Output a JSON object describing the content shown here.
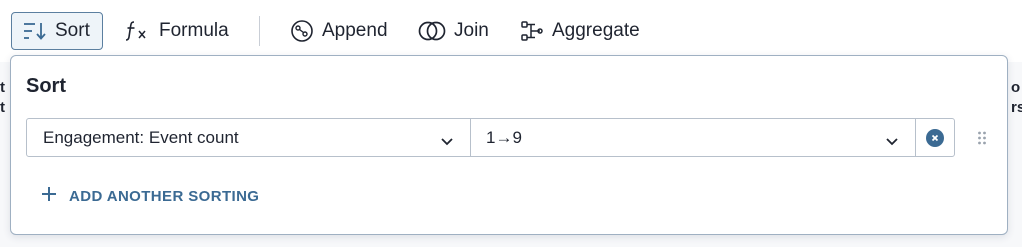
{
  "toolbar": {
    "sort_label": "Sort",
    "formula_label": "Formula",
    "append_label": "Append",
    "join_label": "Join",
    "aggregate_label": "Aggregate"
  },
  "background": {
    "left_stub_line1": "t",
    "left_stub_line2": "t",
    "right_stub_line1": "o",
    "right_stub_line2": "rs"
  },
  "sort_panel": {
    "title": "Sort",
    "rule": {
      "field_value": "Engagement: Event count",
      "order_value": "1→9"
    },
    "add_label": "ADD ANOTHER SORTING"
  },
  "colors": {
    "accent": "#3b6a93",
    "active_border": "#5b7fa0",
    "panel_border": "#9fb0c2"
  }
}
